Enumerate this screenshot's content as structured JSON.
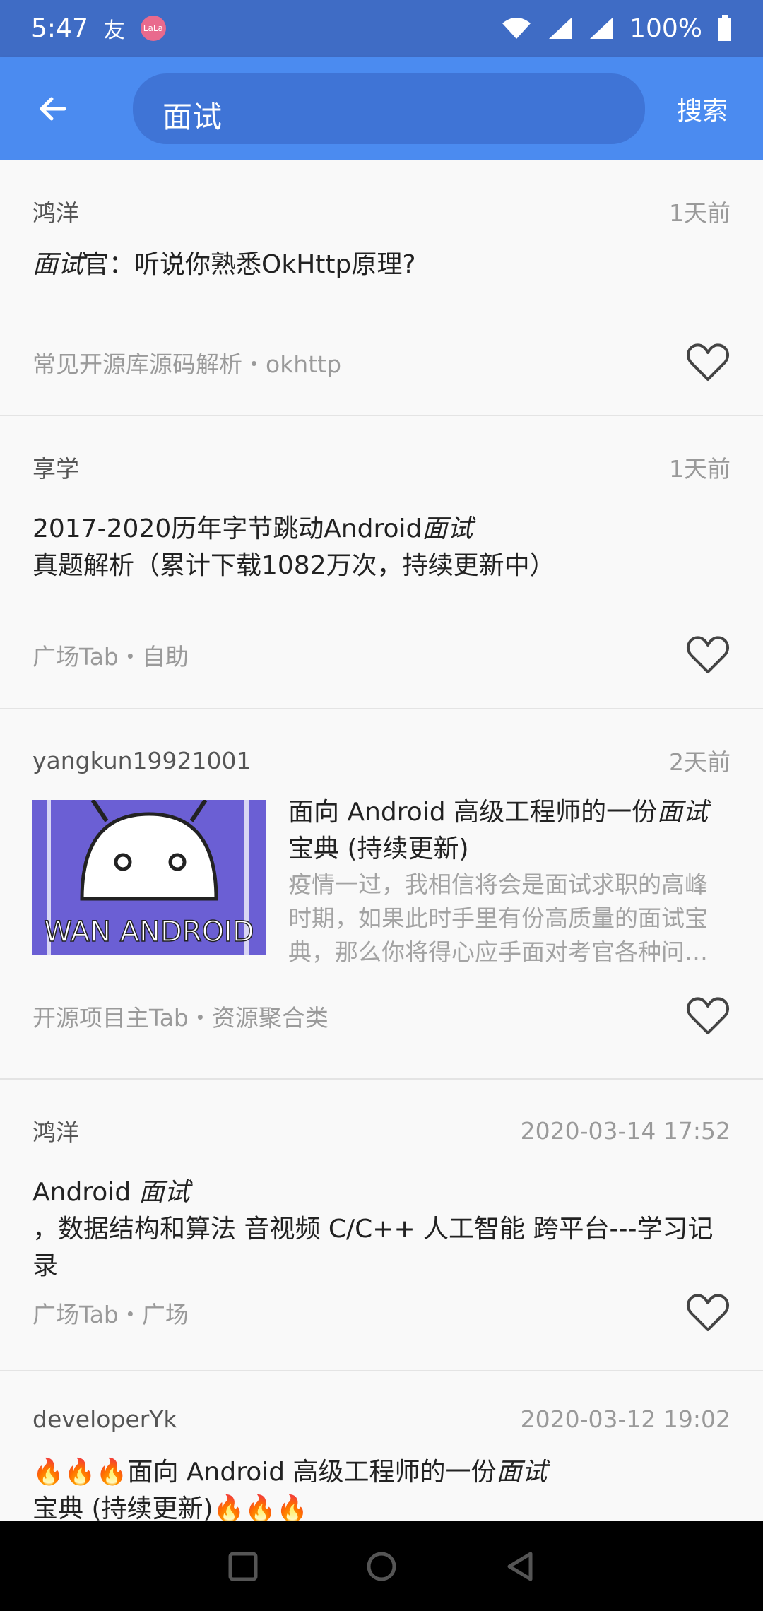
{
  "status": {
    "time": "5:47",
    "battery": "100%"
  },
  "appbar": {
    "search_value": "面试",
    "search_label": "搜索"
  },
  "articles": [
    {
      "author": "鸿洋",
      "time": "1天前",
      "title_em": "面试",
      "title_rest": "官：听说你熟悉OkHttp原理?",
      "chapter": "常见开源库源码解析・okhttp"
    },
    {
      "author": "享学",
      "time": "1天前",
      "title_pre": "2017-2020历年字节跳动Android",
      "title_em": "面试",
      "title_rest": "真题解析（累计下载1082万次，持续更新中）",
      "chapter": "广场Tab・自助"
    },
    {
      "author": "yangkun19921001",
      "time": "2天前",
      "title_pre": "面向 Android 高级工程师的一份",
      "title_em": "面试",
      "title_rest": "宝典 (持续更新)",
      "desc": "疫情一过，我相信将会是面试求职的高峰时期，如果此时手里有份高质量的面试宝典，那么你将得心应手面对考官各种问…",
      "thumb_text": "WAN ANDROID",
      "chapter": "开源项目主Tab・资源聚合类"
    },
    {
      "author": "鸿洋",
      "time": "2020-03-14 17:52",
      "title_pre": "Android ",
      "title_em": "面试",
      "title_rest": "，数据结构和算法 音视频 C/C++ 人工智能 跨平台---学习记录",
      "chapter": "广场Tab・广场"
    },
    {
      "author": "developerYk",
      "time": "2020-03-12 19:02",
      "title_pre": "🔥🔥🔥面向 Android 高级工程师的一份",
      "title_em": "面试",
      "title_rest": "宝典 (持续更新)🔥🔥🔥"
    }
  ]
}
